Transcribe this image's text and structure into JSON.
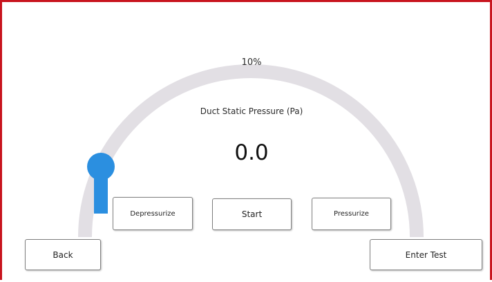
{
  "gauge": {
    "percent_label": "10%",
    "level": 0.1,
    "caption": "Duct Static Pressure (Pa)",
    "value": "0.0",
    "track_color": "#e2dfe4",
    "indicator_color": "#2b8fe0"
  },
  "buttons": {
    "depressurize_label": "Depressurize",
    "start_label": "Start",
    "pressurize_label": "Pressurize",
    "back_label": "Back",
    "enter_test_label": "Enter Test"
  },
  "frame": {
    "border_color": "#c8141e"
  }
}
